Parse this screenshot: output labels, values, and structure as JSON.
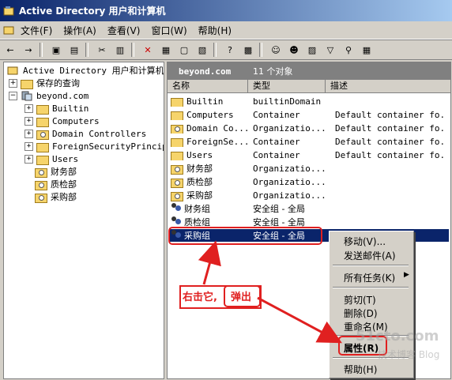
{
  "window": {
    "title": "Active Directory 用户和计算机"
  },
  "menubar": {
    "items": [
      "文件(F)",
      "操作(A)",
      "查看(V)",
      "窗口(W)",
      "帮助(H)"
    ]
  },
  "tree": {
    "root": "Active Directory 用户和计算机",
    "saved_queries": "保存的查询",
    "domain": "beyond.com",
    "children": [
      "Builtin",
      "Computers",
      "Domain Controllers",
      "ForeignSecurityPrincipa",
      "Users",
      "财务部",
      "质检部",
      "采购部"
    ]
  },
  "right": {
    "domain": "beyond.com",
    "count": "11 个对象",
    "columns": [
      "名称",
      "类型",
      "描述"
    ],
    "rows": [
      {
        "name": "Builtin",
        "type": "builtinDomain",
        "desc": ""
      },
      {
        "name": "Computers",
        "type": "Container",
        "desc": "Default container fo..."
      },
      {
        "name": "Domain Co...",
        "type": "Organizatio...",
        "desc": "Default container fo..."
      },
      {
        "name": "ForeignSe...",
        "type": "Container",
        "desc": "Default container fo..."
      },
      {
        "name": "Users",
        "type": "Container",
        "desc": "Default container fo..."
      },
      {
        "name": "财务部",
        "type": "Organizatio...",
        "desc": ""
      },
      {
        "name": "质检部",
        "type": "Organizatio...",
        "desc": ""
      },
      {
        "name": "采购部",
        "type": "Organizatio...",
        "desc": ""
      },
      {
        "name": "财务组",
        "type": "安全组 - 全局",
        "desc": ""
      },
      {
        "name": "质检组",
        "type": "安全组 - 全局",
        "desc": ""
      },
      {
        "name": "采购组",
        "type": "安全组 - 全局",
        "desc": ""
      }
    ]
  },
  "context_menu": {
    "move": "移动(V)...",
    "send_mail": "发送邮件(A)",
    "all_tasks": "所有任务(K)",
    "cut": "剪切(T)",
    "delete": "删除(D)",
    "rename": "重命名(M)",
    "properties": "属性(R)",
    "help": "帮助(H)"
  },
  "annotations": {
    "right_click": "右击它,",
    "popup": "弹出"
  },
  "watermark": {
    "line1": "51cto.com",
    "line2": "技术博客 Blog"
  },
  "colors": {
    "annotation": "#e02020",
    "selection": "#0a246a"
  }
}
